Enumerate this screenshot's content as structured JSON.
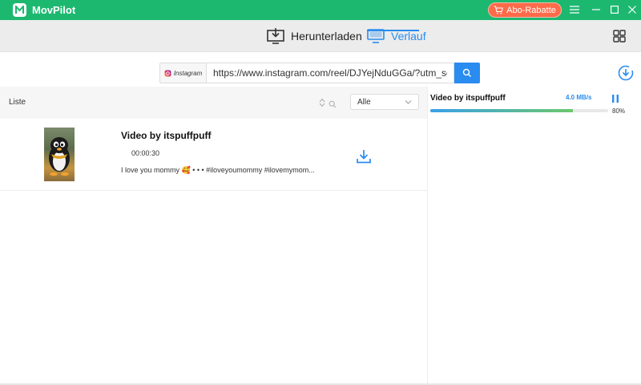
{
  "app": {
    "title": "MovPilot",
    "promo_label": "Abo-Rabatte"
  },
  "nav": {
    "tabs": [
      {
        "label": "Herunterladen",
        "icon": "download-monitor-icon",
        "active": false
      },
      {
        "label": "Verlauf",
        "icon": "monitor-icon",
        "active": true
      }
    ]
  },
  "search": {
    "platform_label": "Instagram",
    "url_value": "https://www.instagram.com/reel/DJYejNduGGa/?utm_source=ig_web_copy_link"
  },
  "list": {
    "header_label": "Liste",
    "filter_value": "Alle",
    "items": [
      {
        "title": "Video by itspuffpuff",
        "duration": "00:00:30",
        "description": "I love you mommy 🥰 • • • #iloveyoumommy #ilovemymom..."
      }
    ]
  },
  "download_panel": {
    "title": "Video by itspuffpuff",
    "speed": "4.0 MB/s",
    "percent_label": "80%",
    "progress": 0.8
  },
  "colors": {
    "brand": "#1db870",
    "accent": "#2a8cf0",
    "promo": "#ff6b4a"
  }
}
